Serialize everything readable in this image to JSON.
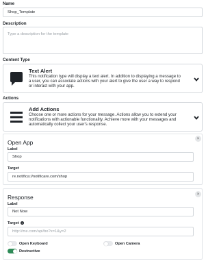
{
  "form": {
    "name_label": "Name",
    "name_value": "Shop_Template",
    "description_label": "Description",
    "description_placeholder": "Type a description for the template",
    "content_type_label": "Content Type",
    "content_type": {
      "title": "Text Alert",
      "description": "This notification type will display a text alert. In addition to displaying a message to a user, you can associate actions with your alert to give the user a way to respond or interact with your app.",
      "icon": "speech-bubble-icon"
    },
    "actions_label": "Actions",
    "actions": {
      "title": "Add Actions",
      "description": "Choose one or more actions for your message. Actions allow you to extend your notifications with actionable functionality. Achieve more with your messages and automatically collect your user's response.",
      "icon": "hamburger-menu-icon"
    }
  },
  "open_app": {
    "title": "Open App",
    "label_label": "Label",
    "label_value": "Shop",
    "target_label": "Target",
    "target_value": "re.notifica://notificare.com/shop",
    "close": "×"
  },
  "response": {
    "title": "Response",
    "label_label": "Label",
    "label_value": "Not Now",
    "target_label": "Target",
    "target_placeholder": "http://me.com/api/bo?x=1&y=2",
    "info": "i",
    "close": "×",
    "toggles": [
      {
        "label": "Open Keyboard",
        "on": false
      },
      {
        "label": "Open Camera",
        "on": false
      },
      {
        "label": "Destructive",
        "on": true
      }
    ]
  },
  "colors": {
    "toggle_on": "#2e8b57",
    "border": "#d3d7dc"
  }
}
